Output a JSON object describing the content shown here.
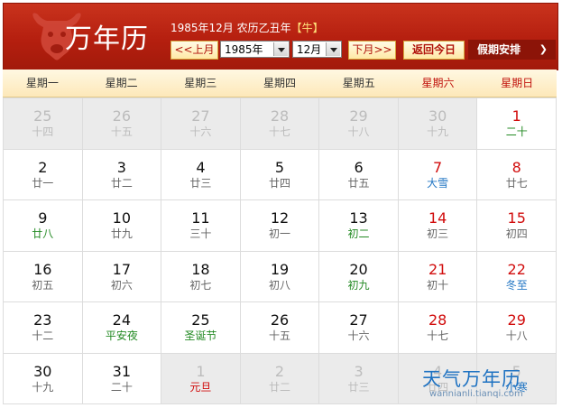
{
  "header": {
    "app_title": "万年历",
    "lunar_info": "1985年12月 农历乙丑年",
    "zodiac_open": "【",
    "zodiac": "牛",
    "zodiac_close": "】",
    "prev_month_label": "<<上月",
    "year_select_value": "1985年",
    "month_select_value": "12月",
    "next_month_label": "下月>>",
    "today_label": "返回今日",
    "holiday_label": "假期安排",
    "holiday_chevron": "❯"
  },
  "weekdays": [
    "星期一",
    "星期二",
    "星期三",
    "星期四",
    "星期五",
    "星期六",
    "星期日"
  ],
  "weeks": [
    [
      {
        "day": "25",
        "sub": "十四",
        "other": true
      },
      {
        "day": "26",
        "sub": "十五",
        "other": true
      },
      {
        "day": "27",
        "sub": "十六",
        "other": true
      },
      {
        "day": "28",
        "sub": "十七",
        "other": true
      },
      {
        "day": "29",
        "sub": "十八",
        "other": true
      },
      {
        "day": "30",
        "sub": "十九",
        "other": true
      },
      {
        "day": "1",
        "sub": "二十",
        "red": true,
        "subColor": "green"
      }
    ],
    [
      {
        "day": "2",
        "sub": "廿一"
      },
      {
        "day": "3",
        "sub": "廿二"
      },
      {
        "day": "4",
        "sub": "廿三"
      },
      {
        "day": "5",
        "sub": "廿四"
      },
      {
        "day": "6",
        "sub": "廿五"
      },
      {
        "day": "7",
        "sub": "大雪",
        "red": true,
        "subColor": "blue"
      },
      {
        "day": "8",
        "sub": "廿七",
        "red": true
      }
    ],
    [
      {
        "day": "9",
        "sub": "廿八",
        "subColor": "green"
      },
      {
        "day": "10",
        "sub": "廿九"
      },
      {
        "day": "11",
        "sub": "三十"
      },
      {
        "day": "12",
        "sub": "初一"
      },
      {
        "day": "13",
        "sub": "初二",
        "subColor": "green"
      },
      {
        "day": "14",
        "sub": "初三",
        "red": true
      },
      {
        "day": "15",
        "sub": "初四",
        "red": true
      }
    ],
    [
      {
        "day": "16",
        "sub": "初五"
      },
      {
        "day": "17",
        "sub": "初六"
      },
      {
        "day": "18",
        "sub": "初七"
      },
      {
        "day": "19",
        "sub": "初八"
      },
      {
        "day": "20",
        "sub": "初九",
        "subColor": "green"
      },
      {
        "day": "21",
        "sub": "初十",
        "red": true
      },
      {
        "day": "22",
        "sub": "冬至",
        "red": true,
        "subColor": "blue"
      }
    ],
    [
      {
        "day": "23",
        "sub": "十二"
      },
      {
        "day": "24",
        "sub": "平安夜",
        "subColor": "green"
      },
      {
        "day": "25",
        "sub": "圣诞节",
        "subColor": "green"
      },
      {
        "day": "26",
        "sub": "十五"
      },
      {
        "day": "27",
        "sub": "十六"
      },
      {
        "day": "28",
        "sub": "十七",
        "red": true
      },
      {
        "day": "29",
        "sub": "十八",
        "red": true
      }
    ],
    [
      {
        "day": "30",
        "sub": "十九"
      },
      {
        "day": "31",
        "sub": "二十"
      },
      {
        "day": "1",
        "sub": "元旦",
        "other": true,
        "subColor": "red"
      },
      {
        "day": "2",
        "sub": "廿二",
        "other": true
      },
      {
        "day": "3",
        "sub": "廿三",
        "other": true
      },
      {
        "day": "4",
        "sub": "廿四",
        "other": true
      },
      {
        "day": "5",
        "sub": "小寒",
        "other": true,
        "subColor": "blue"
      }
    ]
  ],
  "watermark": {
    "title": "天气万年历",
    "url": "wannianli.tianqi.com"
  },
  "colors": {
    "header_red": "#b51f0f",
    "weekend_red": "#d10c0c",
    "festival_green": "#248a24",
    "solar_term_blue": "#2477c4"
  }
}
